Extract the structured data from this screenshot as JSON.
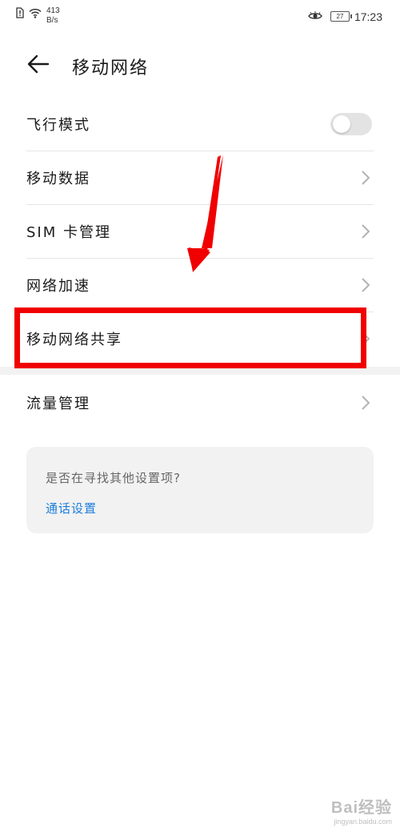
{
  "status_bar": {
    "net_speed_value": "413",
    "net_speed_unit": "B/s",
    "battery": "27",
    "time": "17:23"
  },
  "header": {
    "title": "移动网络"
  },
  "settings": [
    {
      "label": "飞行模式",
      "control": "toggle",
      "toggle_on": false
    },
    {
      "label": "移动数据",
      "control": "chevron"
    },
    {
      "label": "SIM 卡管理",
      "control": "chevron"
    },
    {
      "label": "网络加速",
      "control": "chevron"
    },
    {
      "label": "移动网络共享",
      "control": "chevron",
      "highlighted": true
    },
    {
      "label": "流量管理",
      "control": "chevron"
    }
  ],
  "suggestion_card": {
    "question": "是否在寻找其他设置项?",
    "link": "通话设置"
  },
  "annotation": {
    "color": "#f00000"
  },
  "watermark": {
    "main": "Bai经验",
    "sub": "jingyan.baidu.com"
  },
  "colors": {
    "link": "#1d7ddc",
    "divider": "#e6e6e6",
    "card_bg": "#f2f2f2"
  }
}
